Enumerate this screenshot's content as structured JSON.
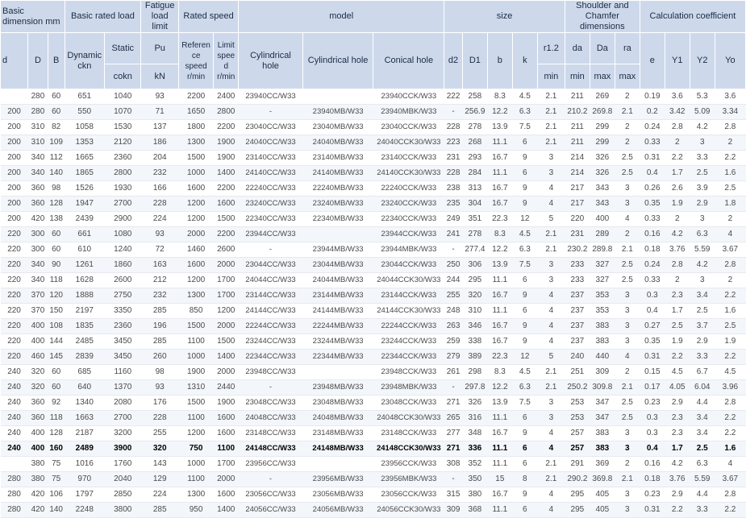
{
  "header": {
    "groups": {
      "basic_dimension": "Basic dimension mm",
      "basic_rated_load": "Basic rated load",
      "fatigue_load_limit": "Fatigue load limit",
      "rated_speed": "Rated speed",
      "model": "model",
      "size": "size",
      "shoulder_chamfer": "Shoulder and Chamfer dimensions",
      "calc_coeff": "Calculation coefficient"
    },
    "sub": {
      "dynamic": "Dynamic ckn",
      "static": "Static",
      "pu": "Pu",
      "reference_speed": "Reference speed r/min",
      "limit_speed": "Limit speed r/min",
      "cyl_hole_1": "Cylindrical hole",
      "cyl_hole_2": "Cylindrical hole",
      "conical_hole": "Conical hole",
      "d2": "d2",
      "D1": "D1",
      "b": "b",
      "k": "k",
      "r12": "r1.2",
      "da": "da",
      "Da": "Da",
      "ra": "ra",
      "e": "e",
      "Y1": "Y1",
      "Y2": "Y2",
      "Yo": "Yo"
    },
    "bottom": {
      "d": "d",
      "D": "D",
      "B": "B",
      "static_unit": "cokn",
      "pu_unit": "kN",
      "r12_unit": "min",
      "da_unit": "min",
      "Da_unit": "max",
      "ra_unit": "max"
    }
  },
  "rows": [
    [
      "",
      "280",
      "60",
      "651",
      "1040",
      "93",
      "2200",
      "2400",
      "23940CC/W33",
      "",
      "23940CCK/W33",
      "222",
      "258",
      "8.3",
      "4.5",
      "2.1",
      "211",
      "269",
      "2",
      "0.19",
      "3.6",
      "5.3",
      "3.6"
    ],
    [
      "200",
      "280",
      "60",
      "550",
      "1070",
      "71",
      "1650",
      "2800",
      "-",
      "23940MB/W33",
      "23940MBK/W33",
      "-",
      "256.9",
      "12.2",
      "6.3",
      "2.1",
      "210.2",
      "269.8",
      "2.1",
      "0.2",
      "3.42",
      "5.09",
      "3.34"
    ],
    [
      "200",
      "310",
      "82",
      "1058",
      "1530",
      "137",
      "1800",
      "2200",
      "23040CC/W33",
      "23040MB/W33",
      "23040CCK/W33",
      "228",
      "278",
      "13.9",
      "7.5",
      "2.1",
      "211",
      "299",
      "2",
      "0.24",
      "2.8",
      "4.2",
      "2.8"
    ],
    [
      "200",
      "310",
      "109",
      "1353",
      "2120",
      "186",
      "1300",
      "1900",
      "24040CC/W33",
      "24040MB/W33",
      "24040CCK30/W33",
      "223",
      "268",
      "11.1",
      "6",
      "2.1",
      "211",
      "299",
      "2",
      "0.33",
      "2",
      "3",
      "2"
    ],
    [
      "200",
      "340",
      "112",
      "1665",
      "2360",
      "204",
      "1500",
      "1900",
      "23140CC/W33",
      "23140MB/W33",
      "23140CCK/W33",
      "231",
      "293",
      "16.7",
      "9",
      "3",
      "214",
      "326",
      "2.5",
      "0.31",
      "2.2",
      "3.3",
      "2.2"
    ],
    [
      "200",
      "340",
      "140",
      "1865",
      "2800",
      "232",
      "1000",
      "1400",
      "24140CC/W33",
      "24140MB/W33",
      "24140CCK30/W33",
      "228",
      "284",
      "11.1",
      "6",
      "3",
      "214",
      "326",
      "2.5",
      "0.4",
      "1.7",
      "2.5",
      "1.6"
    ],
    [
      "200",
      "360",
      "98",
      "1526",
      "1930",
      "166",
      "1600",
      "2200",
      "22240CC/W33",
      "22240MB/W33",
      "22240CCK/W33",
      "238",
      "313",
      "16.7",
      "9",
      "4",
      "217",
      "343",
      "3",
      "0.26",
      "2.6",
      "3.9",
      "2.5"
    ],
    [
      "200",
      "360",
      "128",
      "1947",
      "2700",
      "228",
      "1200",
      "1600",
      "23240CC/W33",
      "23240MB/W33",
      "23240CCK/W33",
      "235",
      "304",
      "16.7",
      "9",
      "4",
      "217",
      "343",
      "3",
      "0.35",
      "1.9",
      "2.9",
      "1.8"
    ],
    [
      "200",
      "420",
      "138",
      "2439",
      "2900",
      "224",
      "1200",
      "1500",
      "22340CC/W33",
      "22340MB/W33",
      "22340CCK/W33",
      "249",
      "351",
      "22.3",
      "12",
      "5",
      "220",
      "400",
      "4",
      "0.33",
      "2",
      "3",
      "2"
    ],
    [
      "220",
      "300",
      "60",
      "661",
      "1080",
      "93",
      "2000",
      "2200",
      "23944CC/W33",
      "",
      "23944CCK/W33",
      "241",
      "278",
      "8.3",
      "4.5",
      "2.1",
      "231",
      "289",
      "2",
      "0.16",
      "4.2",
      "6.3",
      "4"
    ],
    [
      "220",
      "300",
      "60",
      "610",
      "1240",
      "72",
      "1460",
      "2600",
      "-",
      "23944MB/W33",
      "23944MBK/W33",
      "-",
      "277.4",
      "12.2",
      "6.3",
      "2.1",
      "230.2",
      "289.8",
      "2.1",
      "0.18",
      "3.76",
      "5.59",
      "3.67"
    ],
    [
      "220",
      "340",
      "90",
      "1261",
      "1860",
      "163",
      "1600",
      "2000",
      "23044CC/W33",
      "23044MB/W33",
      "23044CCK/W33",
      "250",
      "306",
      "13.9",
      "7.5",
      "3",
      "233",
      "327",
      "2.5",
      "0.24",
      "2.8",
      "4.2",
      "2.8"
    ],
    [
      "220",
      "340",
      "118",
      "1628",
      "2600",
      "212",
      "1200",
      "1700",
      "24044CC/W33",
      "24044MB/W33",
      "24044CCK30/W33",
      "244",
      "295",
      "11.1",
      "6",
      "3",
      "233",
      "327",
      "2.5",
      "0.33",
      "2",
      "3",
      "2"
    ],
    [
      "220",
      "370",
      "120",
      "1888",
      "2750",
      "232",
      "1300",
      "1700",
      "23144CC/W33",
      "23144MB/W33",
      "23144CCK/W33",
      "255",
      "320",
      "16.7",
      "9",
      "4",
      "237",
      "353",
      "3",
      "0.3",
      "2.3",
      "3.4",
      "2.2"
    ],
    [
      "220",
      "370",
      "150",
      "2197",
      "3350",
      "285",
      "850",
      "1200",
      "24144CC/W33",
      "24144MB/W33",
      "24144CCK30/W33",
      "248",
      "310",
      "11.1",
      "6",
      "4",
      "237",
      "353",
      "3",
      "0.4",
      "1.7",
      "2.5",
      "1.6"
    ],
    [
      "220",
      "400",
      "108",
      "1835",
      "2360",
      "196",
      "1500",
      "2000",
      "22244CC/W33",
      "22244MB/W33",
      "22244CCK/W33",
      "263",
      "346",
      "16.7",
      "9",
      "4",
      "237",
      "383",
      "3",
      "0.27",
      "2.5",
      "3.7",
      "2.5"
    ],
    [
      "220",
      "400",
      "144",
      "2485",
      "3450",
      "285",
      "1100",
      "1500",
      "23244CC/W33",
      "23244MB/W33",
      "23244CCK/W33",
      "259",
      "338",
      "16.7",
      "9",
      "4",
      "237",
      "383",
      "3",
      "0.35",
      "1.9",
      "2.9",
      "1.9"
    ],
    [
      "220",
      "460",
      "145",
      "2839",
      "3450",
      "260",
      "1000",
      "1400",
      "22344CC/W33",
      "22344MB/W33",
      "22344CCK/W33",
      "279",
      "389",
      "22.3",
      "12",
      "5",
      "240",
      "440",
      "4",
      "0.31",
      "2.2",
      "3.3",
      "2.2"
    ],
    [
      "240",
      "320",
      "60",
      "685",
      "1160",
      "98",
      "1900",
      "2000",
      "23948CC/W33",
      "",
      "23948CCK/W33",
      "261",
      "298",
      "8.3",
      "4.5",
      "2.1",
      "251",
      "309",
      "2",
      "0.15",
      "4.5",
      "6.7",
      "4.5"
    ],
    [
      "240",
      "320",
      "60",
      "640",
      "1370",
      "93",
      "1310",
      "2440",
      "-",
      "23948MB/W33",
      "23948MBK/W33",
      "-",
      "297.8",
      "12.2",
      "6.3",
      "2.1",
      "250.2",
      "309.8",
      "2.1",
      "0.17",
      "4.05",
      "6.04",
      "3.96"
    ],
    [
      "240",
      "360",
      "92",
      "1340",
      "2080",
      "176",
      "1500",
      "1900",
      "23048CC/W33",
      "23048MB/W33",
      "23048CCK/W33",
      "271",
      "326",
      "13.9",
      "7.5",
      "3",
      "253",
      "347",
      "2.5",
      "0.23",
      "2.9",
      "4.4",
      "2.8"
    ],
    [
      "240",
      "360",
      "118",
      "1663",
      "2700",
      "228",
      "1100",
      "1600",
      "24048CC/W33",
      "24048MB/W33",
      "24048CCK30/W33",
      "265",
      "316",
      "11.1",
      "6",
      "3",
      "253",
      "347",
      "2.5",
      "0.3",
      "2.3",
      "3.4",
      "2.2"
    ],
    [
      "240",
      "400",
      "128",
      "2187",
      "3200",
      "255",
      "1200",
      "1600",
      "23148CC/W33",
      "23148MB/W33",
      "23148CCK/W33",
      "277",
      "348",
      "16.7",
      "9",
      "4",
      "257",
      "383",
      "3",
      "0.3",
      "2.3",
      "3.4",
      "2.2"
    ],
    [
      "240",
      "400",
      "160",
      "2489",
      "3900",
      "320",
      "750",
      "1100",
      "24148CC/W33",
      "24148MB/W33",
      "24148CCK30/W33",
      "271",
      "336",
      "11.1",
      "6",
      "4",
      "257",
      "383",
      "3",
      "0.4",
      "1.7",
      "2.5",
      "1.6"
    ],
    [
      "",
      "380",
      "75",
      "1016",
      "1760",
      "143",
      "1000",
      "1700",
      "23956CC/W33",
      "",
      "23956CCK/W33",
      "308",
      "352",
      "11.1",
      "6",
      "2.1",
      "291",
      "369",
      "2",
      "0.16",
      "4.2",
      "6.3",
      "4"
    ],
    [
      "280",
      "380",
      "75",
      "970",
      "2040",
      "129",
      "1100",
      "2000",
      "-",
      "23956MB/W33",
      "23956MBK/W33",
      "-",
      "350",
      "15",
      "8",
      "2.1",
      "290.2",
      "369.8",
      "2.1",
      "0.18",
      "3.76",
      "5.59",
      "3.67"
    ],
    [
      "280",
      "420",
      "106",
      "1797",
      "2850",
      "224",
      "1300",
      "1600",
      "23056CC/W33",
      "23056MB/W33",
      "23056CCK/W33",
      "315",
      "380",
      "16.7",
      "9",
      "4",
      "295",
      "405",
      "3",
      "0.23",
      "2.9",
      "4.4",
      "2.8"
    ],
    [
      "280",
      "420",
      "140",
      "2248",
      "3800",
      "285",
      "950",
      "1400",
      "24056CC/W33",
      "24056MB/W33",
      "24056CCK30/W33",
      "309",
      "368",
      "11.1",
      "6",
      "4",
      "295",
      "405",
      "3",
      "0.31",
      "2.2",
      "3.3",
      "2.2"
    ]
  ],
  "highlight_row_index": 23,
  "colors": {
    "header_bg": "#cdd9eb",
    "row_alt_bg": "#f3f6fa",
    "text": "#4a4a4a"
  }
}
